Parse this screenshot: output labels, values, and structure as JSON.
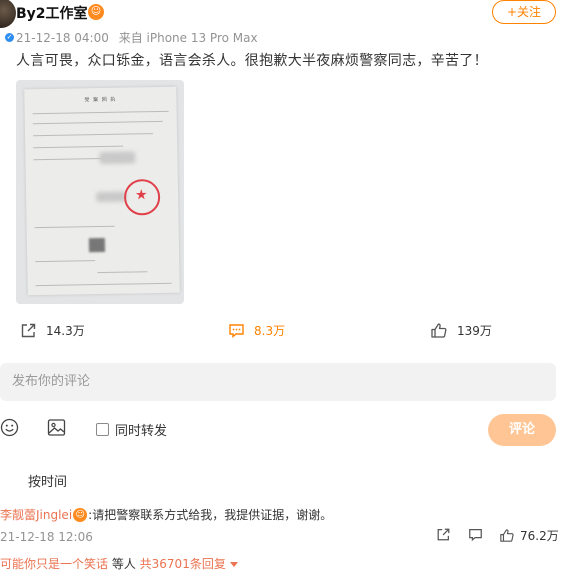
{
  "post": {
    "username": "By2工作室",
    "vip_icon": "vip-face-icon",
    "follow_label": "+关注",
    "time": "21-12-18 04:00",
    "source": "来自 iPhone 13 Pro Max",
    "text": "人言可畏，众口铄金，语言会杀人。很抱歉大半夜麻烦警察同志，辛苦了！",
    "image_doc_title": "受 案 回 执"
  },
  "actions": {
    "repost_count": "14.3万",
    "comment_count": "8.3万",
    "like_count": "139万"
  },
  "composer": {
    "placeholder": "发布你的评论",
    "repost_label": "同时转发",
    "submit_label": "评论"
  },
  "sort_label": "按时间",
  "comment": {
    "username": "李靓蕾Jinglei",
    "text": ":请把警察联系方式给我，我提供证据，谢谢。",
    "time": "21-12-18 12:06",
    "like_count": "76.2万"
  },
  "more_replies": {
    "prefix": "可能你只是一个笑话",
    "middle": " 等人 ",
    "suffix": "共36701条回复"
  },
  "colors": {
    "accent": "#ff8200",
    "link": "#eb7350",
    "submit_disabled": "#ffc594",
    "input_bg": "#f2f2f2"
  }
}
